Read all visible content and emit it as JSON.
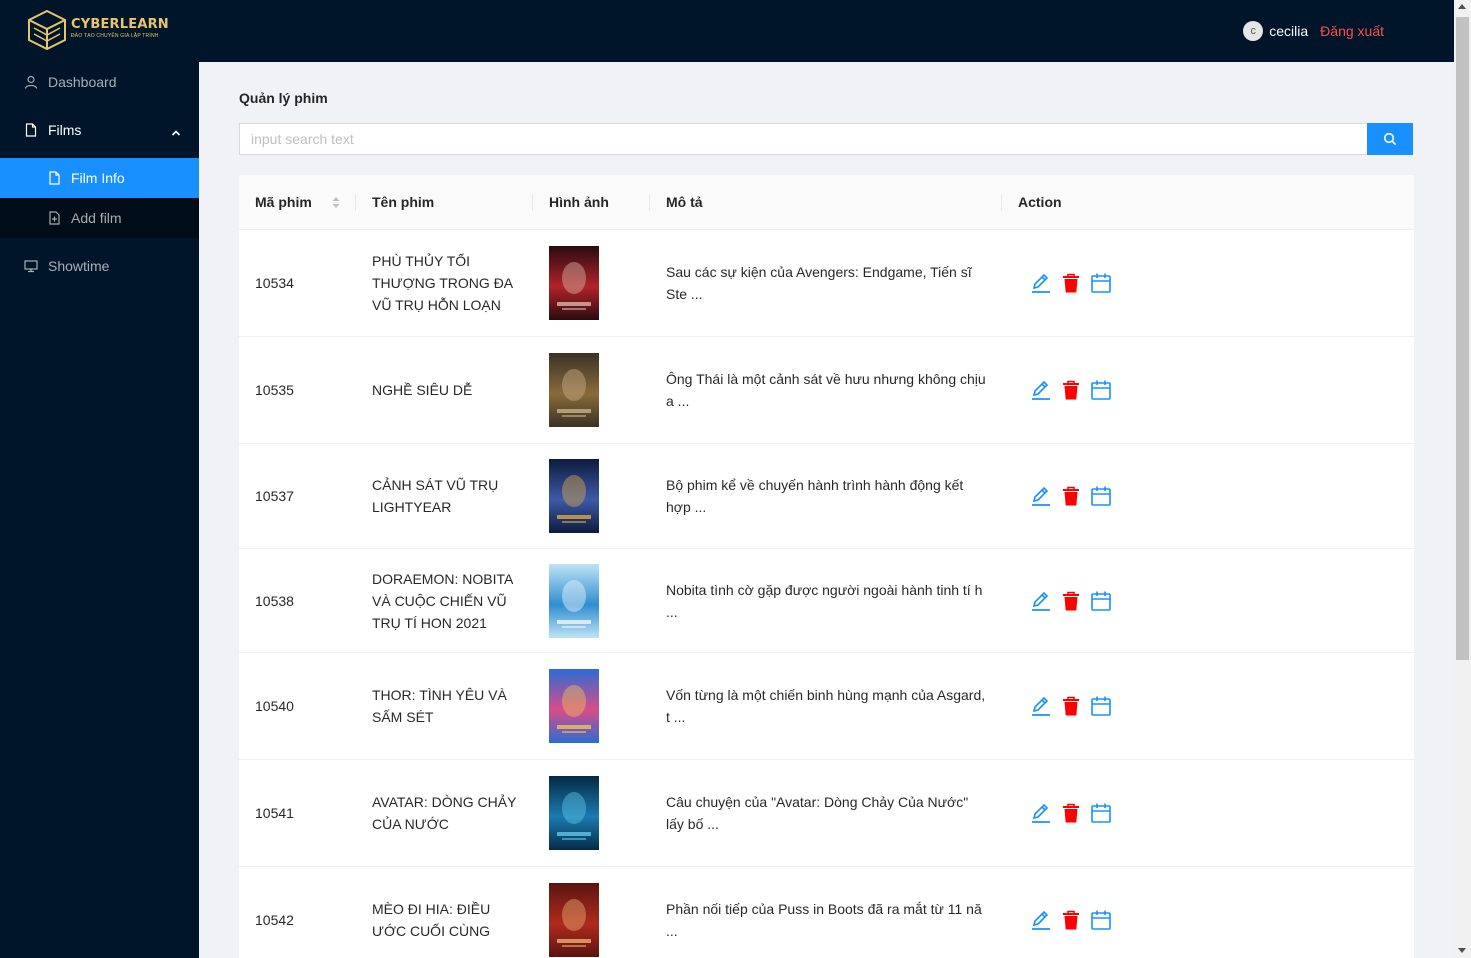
{
  "header": {
    "logo_text": "CYBERLEARN",
    "logo_subtext": "ĐÀO TẠO CHUYÊN GIA LẬP TRÌNH",
    "user_initial": "c",
    "username": "cecilia",
    "logout_label": "Đăng xuất"
  },
  "sidebar": {
    "items": [
      {
        "label": "Dashboard",
        "icon": "user-icon"
      },
      {
        "label": "Films",
        "icon": "file-icon",
        "expanded": true
      },
      {
        "label": "Showtime",
        "icon": "desktop-icon"
      }
    ],
    "sub_items": [
      {
        "label": "Film Info",
        "icon": "file-icon",
        "active": true
      },
      {
        "label": "Add film",
        "icon": "file-add-icon",
        "active": false
      }
    ]
  },
  "main": {
    "title": "Quản lý phim",
    "search_placeholder": "input search text",
    "columns": [
      "Mã phim",
      "Tên phim",
      "Hình ảnh",
      "Mô tả",
      "Action"
    ],
    "rows": [
      {
        "id": "10534",
        "name": "PHÙ THỦY TỐI THƯỢNG TRONG ĐA VŨ TRỤ HỖN LOẠN",
        "desc": "Sau các sự kiện của Avengers: Endgame, Tiến sĩ Ste ...",
        "poster_colors": [
          "#2a0c10",
          "#b3222a",
          "#d8b7a6"
        ]
      },
      {
        "id": "10535",
        "name": "NGHỀ SIÊU DỄ",
        "desc": "Ông Thái là một cảnh sát về hưu nhưng không chịu a ...",
        "poster_colors": [
          "#3a3226",
          "#8a6a3a",
          "#c9b08a"
        ]
      },
      {
        "id": "10537",
        "name": "CẢNH SÁT VŨ TRỤ LIGHTYEAR",
        "desc": "Bộ phim kể về chuyến hành trình hành động kết hợp ...",
        "poster_colors": [
          "#0d1b3d",
          "#3d5aa8",
          "#e0a64a"
        ]
      },
      {
        "id": "10538",
        "name": "DORAEMON: NOBITA VÀ CUỘC CHIẾN VŨ TRỤ TÍ HON 2021",
        "desc": "Nobita tình cờ gặp được người ngoài hành tinh tí h ...",
        "poster_colors": [
          "#bfe3f5",
          "#2f8ed1",
          "#f0f6fa"
        ]
      },
      {
        "id": "10540",
        "name": "THOR: TÌNH YÊU VÀ SẤM SÉT",
        "desc": "Vốn từng là một chiến binh hùng mạnh của Asgard, t ...",
        "poster_colors": [
          "#2b6cd4",
          "#d94c8a",
          "#f2c25a"
        ]
      },
      {
        "id": "10541",
        "name": "AVATAR: DÒNG CHẢY CỦA NƯỚC",
        "desc": "Câu chuyện của \"Avatar: Dòng Chảy Của Nước\" lấy bố ...",
        "poster_colors": [
          "#062a45",
          "#1a7bb0",
          "#5fc6e8"
        ]
      },
      {
        "id": "10542",
        "name": "MÈO ĐI HIA: ĐIỀU ƯỚC CUỐI CÙNG",
        "desc": "Phần nối tiếp của Puss in Boots đã ra mắt từ 11 nă ...",
        "poster_colors": [
          "#5a1410",
          "#b02a1e",
          "#e8b070"
        ]
      }
    ]
  },
  "colors": {
    "primary": "#1890ff",
    "danger": "#ff0000",
    "sider": "#001529",
    "logo": "#e9c46a"
  }
}
